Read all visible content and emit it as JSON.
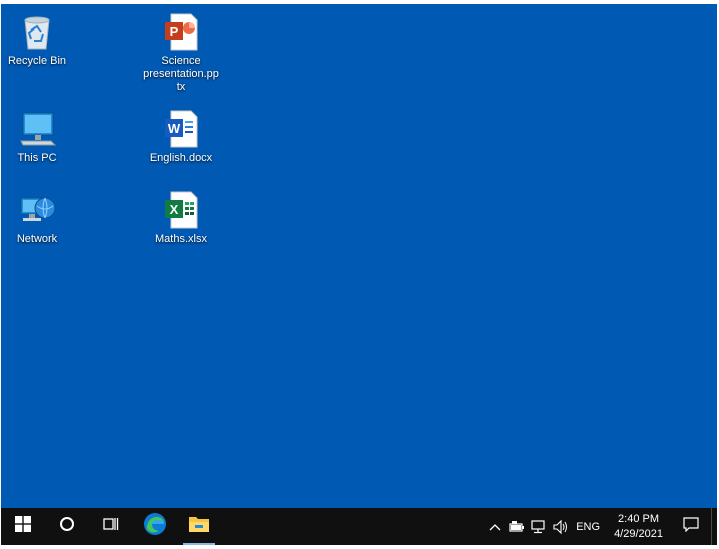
{
  "desktop": {
    "background": "#0059b3",
    "icons": [
      {
        "label": "Recycle Bin",
        "icon": "recycle-bin-icon"
      },
      {
        "label": "This PC",
        "icon": "this-pc-icon"
      },
      {
        "label": "Network",
        "icon": "network-icon"
      },
      {
        "label": "Science presentation.pptx",
        "icon": "powerpoint-file-icon"
      },
      {
        "label": "English.docx",
        "icon": "word-file-icon"
      },
      {
        "label": "Maths.xlsx",
        "icon": "excel-file-icon"
      }
    ]
  },
  "taskbar": {
    "buttons": [
      "windows-start-icon",
      "search-circle-icon",
      "task-view-icon",
      "edge-browser-icon",
      "file-explorer-icon"
    ],
    "tray": {
      "icons": [
        "chevron-up-icon",
        "battery-icon",
        "network-status-icon",
        "volume-icon"
      ],
      "language": "ENG",
      "time": "2:40 PM",
      "date": "4/29/2021",
      "notification_icon": "action-center-icon"
    }
  }
}
